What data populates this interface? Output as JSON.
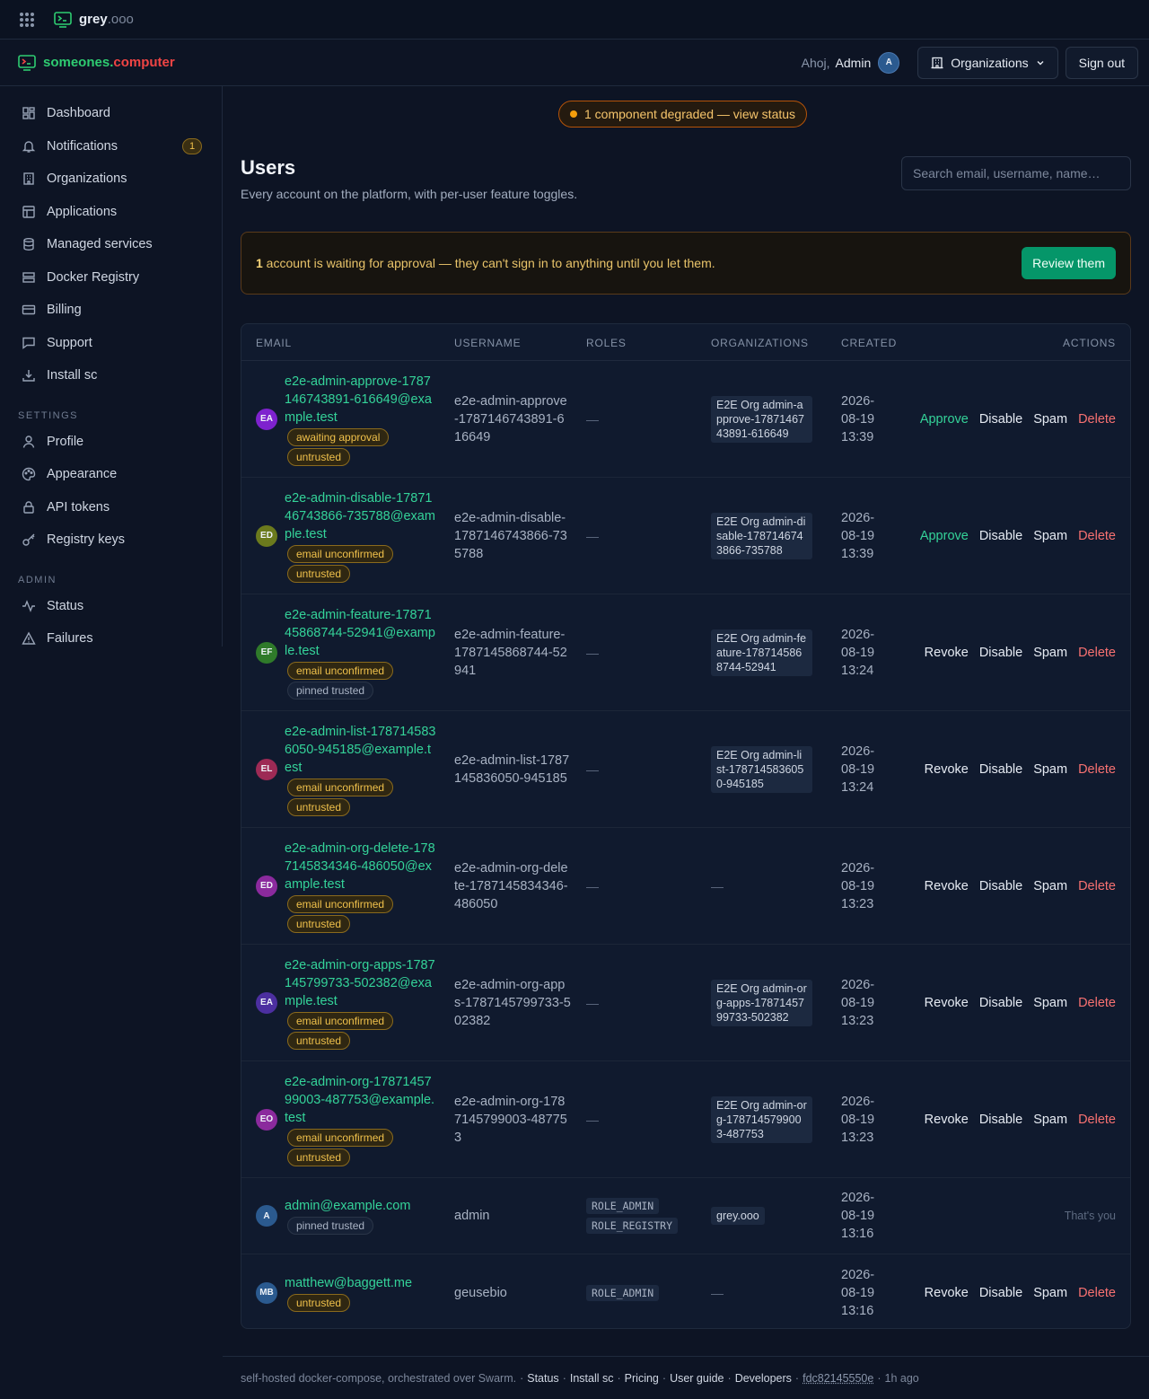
{
  "topbar": {
    "brand_main": "grey",
    "brand_suffix": ".ooo"
  },
  "header": {
    "logo_part1": "someones.",
    "logo_part2": "computer",
    "greeting": "Ahoj,",
    "user_name": "Admin",
    "avatar": "A",
    "organizations_label": "Organizations",
    "signout_label": "Sign out"
  },
  "sidebar": {
    "items": [
      {
        "label": "Dashboard",
        "icon": "dashboard-icon"
      },
      {
        "label": "Notifications",
        "icon": "bell-icon",
        "badge": "1"
      },
      {
        "label": "Organizations",
        "icon": "building-icon"
      },
      {
        "label": "Applications",
        "icon": "layout-icon"
      },
      {
        "label": "Managed services",
        "icon": "database-icon"
      },
      {
        "label": "Docker Registry",
        "icon": "server-icon"
      },
      {
        "label": "Billing",
        "icon": "card-icon"
      },
      {
        "label": "Support",
        "icon": "chat-icon"
      },
      {
        "label": "Install sc",
        "icon": "download-icon"
      }
    ],
    "settings_heading": "SETTINGS",
    "settings_items": [
      {
        "label": "Profile",
        "icon": "user-icon"
      },
      {
        "label": "Appearance",
        "icon": "palette-icon"
      },
      {
        "label": "API tokens",
        "icon": "lock-icon"
      },
      {
        "label": "Registry keys",
        "icon": "key-icon"
      }
    ],
    "admin_heading": "ADMIN",
    "admin_items": [
      {
        "label": "Status",
        "icon": "activity-icon"
      },
      {
        "label": "Failures",
        "icon": "warning-icon"
      }
    ]
  },
  "status_banner": "1 component degraded — view status",
  "page": {
    "title": "Users",
    "subtitle": "Every account on the platform, with per-user feature toggles.",
    "search_placeholder": "Search email, username, name…"
  },
  "approval": {
    "count": "1",
    "text": " account is waiting for approval — they can't sign in to anything until you let them.",
    "button": "Review them"
  },
  "table": {
    "headers": {
      "email": "EMAIL",
      "username": "USERNAME",
      "roles": "ROLES",
      "organizations": "ORGANIZATIONS",
      "created": "CREATED",
      "actions": "ACTIONS"
    },
    "rows": [
      {
        "initials": "EA",
        "avatar_color": "#7e22ce",
        "email": "e2e-admin-approve-1787146743891-616649@example.test",
        "badges": [
          {
            "text": "awaiting approval",
            "kind": "amber"
          },
          {
            "text": "untrusted",
            "kind": "amber"
          }
        ],
        "username": "e2e-admin-approve-1787146743891-616649",
        "roles": [],
        "org": "E2E Org admin-approve-1787146743891-616649",
        "created": "2026-08-19 13:39",
        "actions": [
          "Approve",
          "Disable",
          "Spam",
          "Delete"
        ]
      },
      {
        "initials": "ED",
        "avatar_color": "#6b7a1d",
        "email": "e2e-admin-disable-1787146743866-735788@example.test",
        "badges": [
          {
            "text": "email unconfirmed",
            "kind": "amber"
          },
          {
            "text": "untrusted",
            "kind": "amber"
          }
        ],
        "username": "e2e-admin-disable-1787146743866-735788",
        "roles": [],
        "org": "E2E Org admin-disable-1787146743866-735788",
        "created": "2026-08-19 13:39",
        "actions": [
          "Approve",
          "Disable",
          "Spam",
          "Delete"
        ]
      },
      {
        "initials": "EF",
        "avatar_color": "#2f7a2a",
        "email": "e2e-admin-feature-1787145868744-52941@example.test",
        "badges": [
          {
            "text": "email unconfirmed",
            "kind": "amber"
          },
          {
            "text": "pinned trusted",
            "kind": "gray"
          }
        ],
        "username": "e2e-admin-feature-1787145868744-52941",
        "roles": [],
        "org": "E2E Org admin-feature-1787145868744-52941",
        "created": "2026-08-19 13:24",
        "actions": [
          "Revoke",
          "Disable",
          "Spam",
          "Delete"
        ]
      },
      {
        "initials": "EL",
        "avatar_color": "#9d2a55",
        "email": "e2e-admin-list-1787145836050-945185@example.test",
        "badges": [
          {
            "text": "email unconfirmed",
            "kind": "amber"
          },
          {
            "text": "untrusted",
            "kind": "amber"
          }
        ],
        "username": "e2e-admin-list-1787145836050-945185",
        "roles": [],
        "org": "E2E Org admin-list-1787145836050-945185",
        "created": "2026-08-19 13:24",
        "actions": [
          "Revoke",
          "Disable",
          "Spam",
          "Delete"
        ]
      },
      {
        "initials": "ED",
        "avatar_color": "#8b2a9d",
        "email": "e2e-admin-org-delete-1787145834346-486050@example.test",
        "badges": [
          {
            "text": "email unconfirmed",
            "kind": "amber"
          },
          {
            "text": "untrusted",
            "kind": "amber"
          }
        ],
        "username": "e2e-admin-org-delete-1787145834346-486050",
        "roles": [],
        "org": "",
        "created": "2026-08-19 13:23",
        "actions": [
          "Revoke",
          "Disable",
          "Spam",
          "Delete"
        ]
      },
      {
        "initials": "EA",
        "avatar_color": "#4c2fa0",
        "email": "e2e-admin-org-apps-1787145799733-502382@example.test",
        "badges": [
          {
            "text": "email unconfirmed",
            "kind": "amber"
          },
          {
            "text": "untrusted",
            "kind": "amber"
          }
        ],
        "username": "e2e-admin-org-apps-1787145799733-502382",
        "roles": [],
        "org": "E2E Org admin-org-apps-1787145799733-502382",
        "created": "2026-08-19 13:23",
        "actions": [
          "Revoke",
          "Disable",
          "Spam",
          "Delete"
        ]
      },
      {
        "initials": "EO",
        "avatar_color": "#8b2a9d",
        "email": "e2e-admin-org-1787145799003-487753@example.test",
        "badges": [
          {
            "text": "email unconfirmed",
            "kind": "amber"
          },
          {
            "text": "untrusted",
            "kind": "amber"
          }
        ],
        "username": "e2e-admin-org-1787145799003-487753",
        "roles": [],
        "org": "E2E Org admin-org-1787145799003-487753",
        "created": "2026-08-19 13:23",
        "actions": [
          "Revoke",
          "Disable",
          "Spam",
          "Delete"
        ]
      },
      {
        "initials": "A",
        "avatar_color": "#2b5a8f",
        "email": "admin@example.com",
        "badges": [
          {
            "text": "pinned trusted",
            "kind": "gray"
          }
        ],
        "username": "admin",
        "roles": [
          "ROLE_ADMIN",
          "ROLE_REGISTRY"
        ],
        "org_inline": "grey.ooo",
        "org": "",
        "created": "2026-08-19 13:16",
        "actions": [],
        "self_note": "That's you"
      },
      {
        "initials": "MB",
        "avatar_color": "#2b5a8f",
        "email": "matthew@baggett.me",
        "badges": [
          {
            "text": "untrusted",
            "kind": "amber"
          }
        ],
        "username": "geusebio",
        "roles": [
          "ROLE_ADMIN"
        ],
        "org": "",
        "created": "2026-08-19 13:16",
        "actions": [
          "Revoke",
          "Disable",
          "Spam",
          "Delete"
        ]
      }
    ],
    "empty_dash": "—"
  },
  "footer": {
    "text": "self-hosted docker-compose, orchestrated over Swarm.",
    "links": [
      "Status",
      "Install sc",
      "Pricing",
      "User guide",
      "Developers"
    ],
    "commit": "fdc82145550e",
    "ago": "1h ago"
  }
}
